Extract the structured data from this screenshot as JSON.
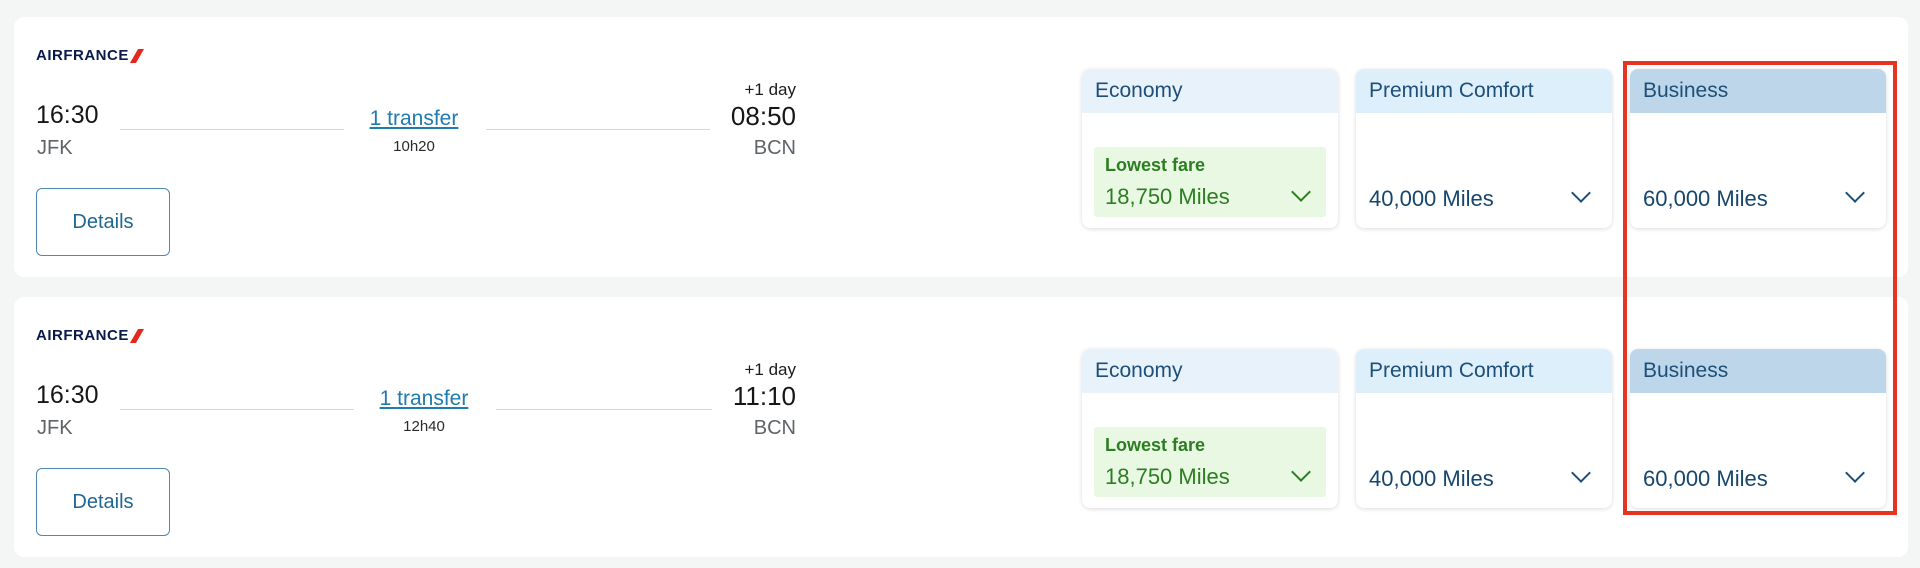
{
  "flights": [
    {
      "airline": "AIRFRANCE",
      "departure": {
        "time": "16:30",
        "airport": "JFK"
      },
      "arrival": {
        "day_offset": "+1 day",
        "time": "08:50",
        "airport": "BCN"
      },
      "transfer": "1 transfer",
      "duration": "10h20",
      "details_label": "Details",
      "fares": {
        "economy": {
          "name": "Economy",
          "badge": "Lowest fare",
          "miles": "18,750 Miles"
        },
        "premium": {
          "name": "Premium Comfort",
          "miles": "40,000 Miles"
        },
        "business": {
          "name": "Business",
          "miles": "60,000 Miles"
        }
      }
    },
    {
      "airline": "AIRFRANCE",
      "departure": {
        "time": "16:30",
        "airport": "JFK"
      },
      "arrival": {
        "day_offset": "+1 day",
        "time": "11:10",
        "airport": "BCN"
      },
      "transfer": "1 transfer",
      "duration": "12h40",
      "details_label": "Details",
      "fares": {
        "economy": {
          "name": "Economy",
          "badge": "Lowest fare",
          "miles": "18,750 Miles"
        },
        "premium": {
          "name": "Premium Comfort",
          "miles": "40,000 Miles"
        },
        "business": {
          "name": "Business",
          "miles": "60,000 Miles"
        }
      }
    }
  ],
  "icons": {
    "logo_mark": "airfrance-slash-logo",
    "expand": "chevron-down-icon"
  },
  "colors": {
    "link": "#1f7bb0",
    "lowest_fare_green": "#2d7d21",
    "fare_text": "#16466d",
    "highlight_frame": "#e53520"
  }
}
